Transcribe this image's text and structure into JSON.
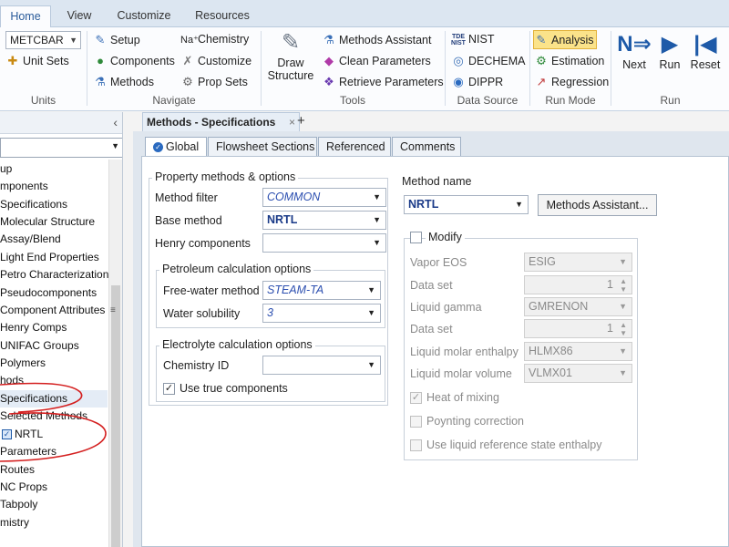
{
  "ribbon": {
    "tabs": [
      {
        "label": "Home",
        "active": true
      },
      {
        "label": "View"
      },
      {
        "label": "Customize"
      },
      {
        "label": "Resources"
      }
    ],
    "units": {
      "unit_set_value": "METCBAR",
      "unit_sets_label": "Unit Sets",
      "group_label": "Units"
    },
    "navigate": {
      "setup": "Setup",
      "components": "Components",
      "methods": "Methods",
      "chemistry": "Chemistry",
      "customize": "Customize",
      "prop_sets": "Prop Sets",
      "group_label": "Navigate"
    },
    "tools": {
      "draw_structure_line1": "Draw",
      "draw_structure_line2": "Structure",
      "methods_assistant": "Methods Assistant",
      "clean_parameters": "Clean Parameters",
      "retrieve_parameters": "Retrieve Parameters",
      "group_label": "Tools"
    },
    "data_source": {
      "nist": "NIST",
      "nist_badge_line1": "TDE",
      "nist_badge_line2": "NIST",
      "dechema": "DECHEMA",
      "dippr": "DIPPR",
      "group_label": "Data Source"
    },
    "run_mode": {
      "analysis": "Analysis",
      "estimation": "Estimation",
      "regression": "Regression",
      "group_label": "Run Mode"
    },
    "run": {
      "next": "Next",
      "run": "Run",
      "reset": "Reset",
      "group_label": "Run"
    }
  },
  "nav": {
    "items": [
      "up",
      "mponents",
      "Specifications",
      "Molecular Structure",
      "Assay/Blend",
      "Light End Properties",
      "Petro Characterization",
      "Pseudocomponents",
      "Component Attributes",
      "Henry Comps",
      "UNIFAC Groups",
      "Polymers",
      "hods",
      "Specifications",
      "Selected Methods",
      "NRTL",
      "Parameters",
      "Routes",
      "NC Props",
      "Tabpoly",
      "mistry"
    ]
  },
  "document": {
    "tab_title": "Methods - Specifications",
    "panel_tabs": [
      "Global",
      "Flowsheet Sections",
      "Referenced",
      "Comments"
    ]
  },
  "form": {
    "property_methods": {
      "legend": "Property methods & options",
      "method_filter_label": "Method filter",
      "method_filter_value": "COMMON",
      "base_method_label": "Base method",
      "base_method_value": "NRTL",
      "henry_label": "Henry components",
      "henry_value": ""
    },
    "petroleum": {
      "legend": "Petroleum calculation options",
      "free_water_label": "Free-water method",
      "free_water_value": "STEAM-TA",
      "water_solubility_label": "Water solubility",
      "water_solubility_value": "3"
    },
    "electrolyte": {
      "legend": "Electrolyte calculation options",
      "chemistry_label": "Chemistry ID",
      "chemistry_value": "",
      "use_true_label": "Use true components",
      "use_true_checked": true
    },
    "method_name": {
      "label": "Method name",
      "value": "NRTL",
      "assistant_button": "Methods Assistant..."
    },
    "modify": {
      "label": "Modify",
      "checked": false,
      "vapor_eos_label": "Vapor EOS",
      "vapor_eos_value": "ESIG",
      "data_set1_label": "Data set",
      "data_set1_value": "1",
      "liquid_gamma_label": "Liquid gamma",
      "liquid_gamma_value": "GMRENON",
      "data_set2_label": "Data set",
      "data_set2_value": "1",
      "liq_enthalpy_label": "Liquid molar enthalpy",
      "liq_enthalpy_value": "HLMX86",
      "liq_volume_label": "Liquid molar volume",
      "liq_volume_value": "VLMX01",
      "heat_of_mixing_label": "Heat of mixing",
      "heat_of_mixing_checked": true,
      "poynting_label": "Poynting correction",
      "poynting_checked": false,
      "liq_ref_label": "Use liquid reference state enthalpy",
      "liq_ref_checked": false
    }
  },
  "colors": {
    "accent": "#1e5aa8",
    "annotation": "#d42020",
    "analysis_highlight": "#fbe38a"
  }
}
